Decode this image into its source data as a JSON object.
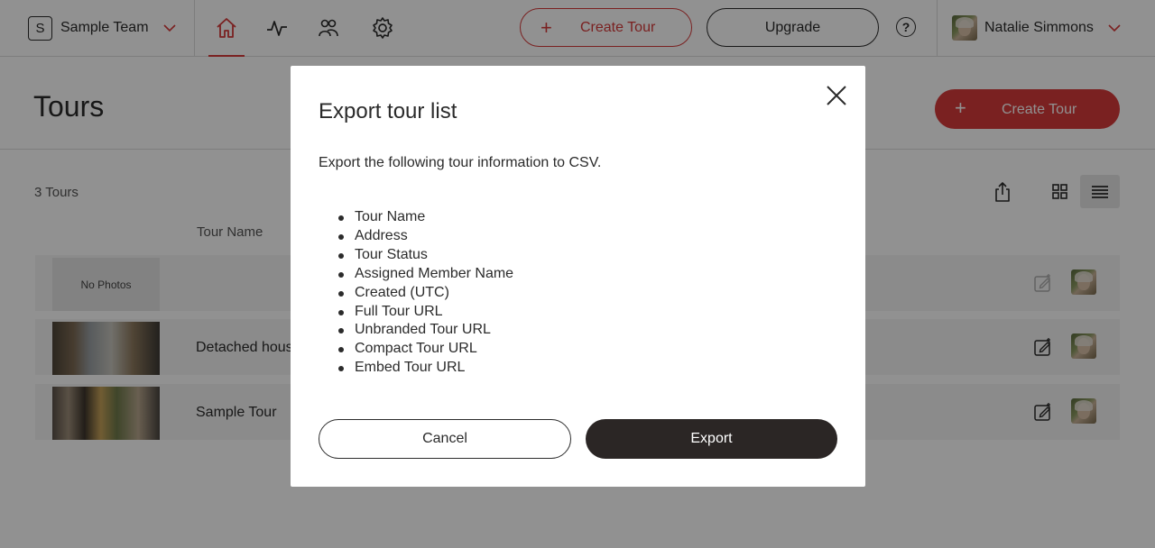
{
  "topbar": {
    "team_initial": "S",
    "team_name": "Sample Team",
    "nav": [
      "home-icon",
      "activity-icon",
      "people-icon",
      "settings-icon"
    ],
    "create_tour": "Create Tour",
    "upgrade": "Upgrade",
    "help": "?",
    "user_name": "Natalie Simmons"
  },
  "page": {
    "title": "Tours",
    "create_tour": "Create Tour",
    "count": "3 Tours",
    "column_tour_name": "Tour Name"
  },
  "tours": [
    {
      "name": "",
      "thumb_label": "No Photos"
    },
    {
      "name": "Detached hous",
      "thumb_label": ""
    },
    {
      "name": "Sample Tour",
      "thumb_label": ""
    }
  ],
  "modal": {
    "title": "Export tour list",
    "description": "Export the following tour information to CSV.",
    "fields": [
      "Tour Name",
      "Address",
      "Tour Status",
      "Assigned Member Name",
      "Created (UTC)",
      "Full Tour URL",
      "Unbranded Tour URL",
      "Compact Tour URL",
      "Embed Tour URL"
    ],
    "cancel": "Cancel",
    "export": "Export"
  },
  "colors": {
    "accent": "#d63a3a",
    "dark_button": "#2b2625",
    "overlay": "rgba(0,0,0,0.43)"
  }
}
